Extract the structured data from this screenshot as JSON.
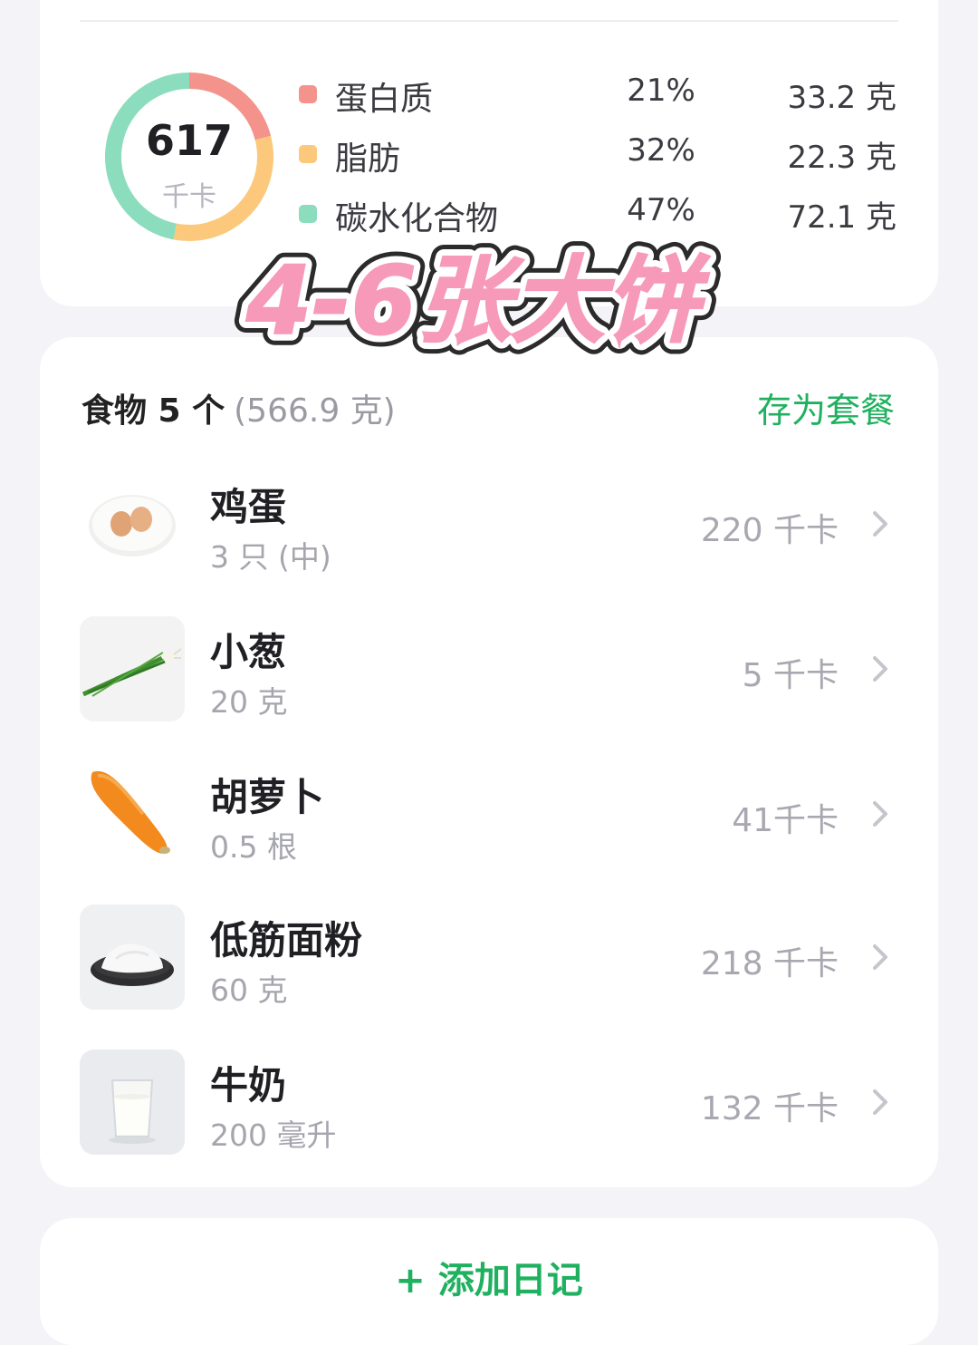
{
  "summary": {
    "kcal_value": "617",
    "kcal_unit": "千卡",
    "macros": [
      {
        "name": "蛋白质",
        "pct": "21%",
        "grams": "33.2 克",
        "color": "#f4938c",
        "fraction": 0.21
      },
      {
        "name": "脂肪",
        "pct": "32%",
        "grams": "22.3 克",
        "color": "#fcc97c",
        "fraction": 0.32
      },
      {
        "name": "碳水化合物",
        "pct": "47%",
        "grams": "72.1 克",
        "color": "#8bddbd",
        "fraction": 0.47
      }
    ]
  },
  "overlay": {
    "sticker_text": "4-6张大饼"
  },
  "food": {
    "count_label": "食物 5 个",
    "total_weight": "(566.9 克)",
    "save_label": "存为套餐",
    "items": [
      {
        "name": "鸡蛋",
        "qty": "3 只 (中)",
        "kcal": "220 千卡",
        "icon": "egg-plate-icon"
      },
      {
        "name": "小葱",
        "qty": "20 克",
        "kcal": "5 千卡",
        "icon": "scallion-icon"
      },
      {
        "name": "胡萝卜",
        "qty": "0.5 根",
        "kcal": "41千卡",
        "icon": "carrot-icon"
      },
      {
        "name": "低筋面粉",
        "qty": "60 克",
        "kcal": "218 千卡",
        "icon": "flour-icon"
      },
      {
        "name": "牛奶",
        "qty": "200 毫升",
        "kcal": "132 千卡",
        "icon": "milk-glass-icon"
      }
    ]
  },
  "footer": {
    "add_diary_label": "+ 添加日记"
  },
  "colors": {
    "accent_green": "#1fb15f",
    "sticker_pink": "#f799b8"
  }
}
